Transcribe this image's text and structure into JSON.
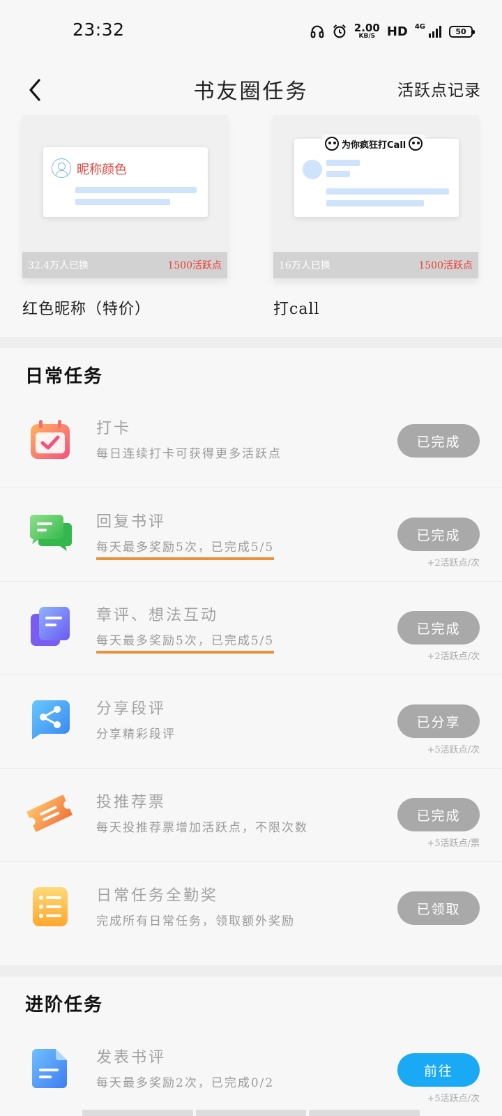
{
  "status_bar": {
    "time": "23:32",
    "net_speed_value": "2.00",
    "net_speed_unit": "KB/S",
    "hd": "HD",
    "network": "4G",
    "battery": "50"
  },
  "header": {
    "title": "书友圈任务",
    "records_link": "活跃点记录",
    "back_icon": "chevron-left-icon"
  },
  "rewards": [
    {
      "name": "红色昵称（特价）",
      "preview_text": "昵称颜色",
      "exchanged": "32.4万人已换",
      "cost": "1500活跃点"
    },
    {
      "name": "打call",
      "preview_text": "为你疯狂打Call",
      "exchanged": "16万人已换",
      "cost": "1500活跃点"
    }
  ],
  "daily": {
    "title": "日常任务",
    "tasks": [
      {
        "title": "打卡",
        "desc": "每日连续打卡可获得更多活跃点",
        "button": "已完成",
        "reward": "",
        "icon": "calendar-check-icon"
      },
      {
        "title": "回复书评",
        "desc": "每天最多奖励5次，已完成5/5",
        "button": "已完成",
        "reward": "+2活跃点/次",
        "icon": "chat-bubbles-icon"
      },
      {
        "title": "章评、想法互动",
        "desc": "每天最多奖励5次，已完成5/5",
        "button": "已完成",
        "reward": "+2活跃点/次",
        "icon": "document-stack-icon"
      },
      {
        "title": "分享段评",
        "desc": "分享精彩段评",
        "button": "已分享",
        "reward": "+5活跃点/次",
        "icon": "share-icon"
      },
      {
        "title": "投推荐票",
        "desc": "每天投推荐票增加活跃点，不限次数",
        "button": "已完成",
        "reward": "+5活跃点/票",
        "icon": "ticket-icon"
      },
      {
        "title": "日常任务全勤奖",
        "desc": "完成所有日常任务，领取额外奖励",
        "button": "已领取",
        "reward": "",
        "icon": "list-icon"
      }
    ]
  },
  "advanced": {
    "title": "进阶任务",
    "tasks": [
      {
        "title": "发表书评",
        "desc": "每天最多奖励2次，已完成0/2",
        "button": "前往",
        "reward": "+5活跃点/次",
        "icon": "document-icon"
      }
    ]
  },
  "colors": {
    "accent_blue": "#1aa9f4",
    "disabled_gray": "#a9a9a9",
    "price_red": "#f03a2e",
    "underline_orange": "#e9923a"
  }
}
